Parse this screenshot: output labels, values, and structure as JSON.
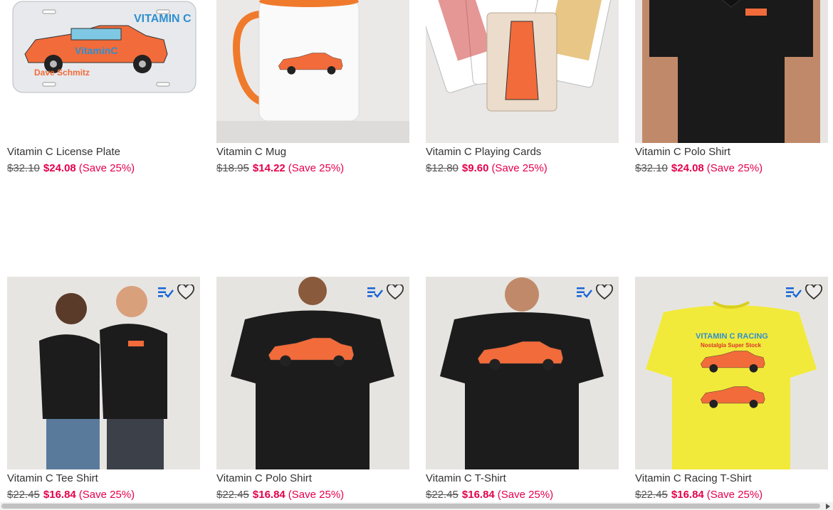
{
  "products": [
    {
      "title": "Vitamin C License Plate",
      "old_price": "$32.10",
      "new_price": "$24.08",
      "save": "(Save 25%)",
      "art_text": "VITAMIN C",
      "plate_text": "Dave Schmitz"
    },
    {
      "title": "Vitamin C Mug",
      "old_price": "$18.95",
      "new_price": "$14.22",
      "save": "(Save 25%)"
    },
    {
      "title": "Vitamin C Playing Cards",
      "old_price": "$12.80",
      "new_price": "$9.60",
      "save": "(Save 25%)"
    },
    {
      "title": "Vitamin C Polo Shirt",
      "old_price": "$32.10",
      "new_price": "$24.08",
      "save": "(Save 25%)"
    },
    {
      "title": "Vitamin C Tee Shirt",
      "old_price": "$22.45",
      "new_price": "$16.84",
      "save": "(Save 25%)"
    },
    {
      "title": "Vitamin C Polo Shirt",
      "old_price": "$22.45",
      "new_price": "$16.84",
      "save": "(Save 25%)"
    },
    {
      "title": "Vitamin C T-Shirt",
      "old_price": "$22.45",
      "new_price": "$16.84",
      "save": "(Save 25%)"
    },
    {
      "title": "Vitamin C Racing T-Shirt",
      "old_price": "$22.45",
      "new_price": "$16.84",
      "save": "(Save 25%)",
      "shirt_text_1": "VITAMIN C RACING",
      "shirt_text_2": "Nostalgia Super Stock"
    }
  ],
  "icons": {
    "compare": "compare-list-icon",
    "favorite": "heart-icon"
  },
  "colors": {
    "sale": "#e5004b",
    "compare_icon": "#1565d8",
    "car": "#f26b3a"
  }
}
